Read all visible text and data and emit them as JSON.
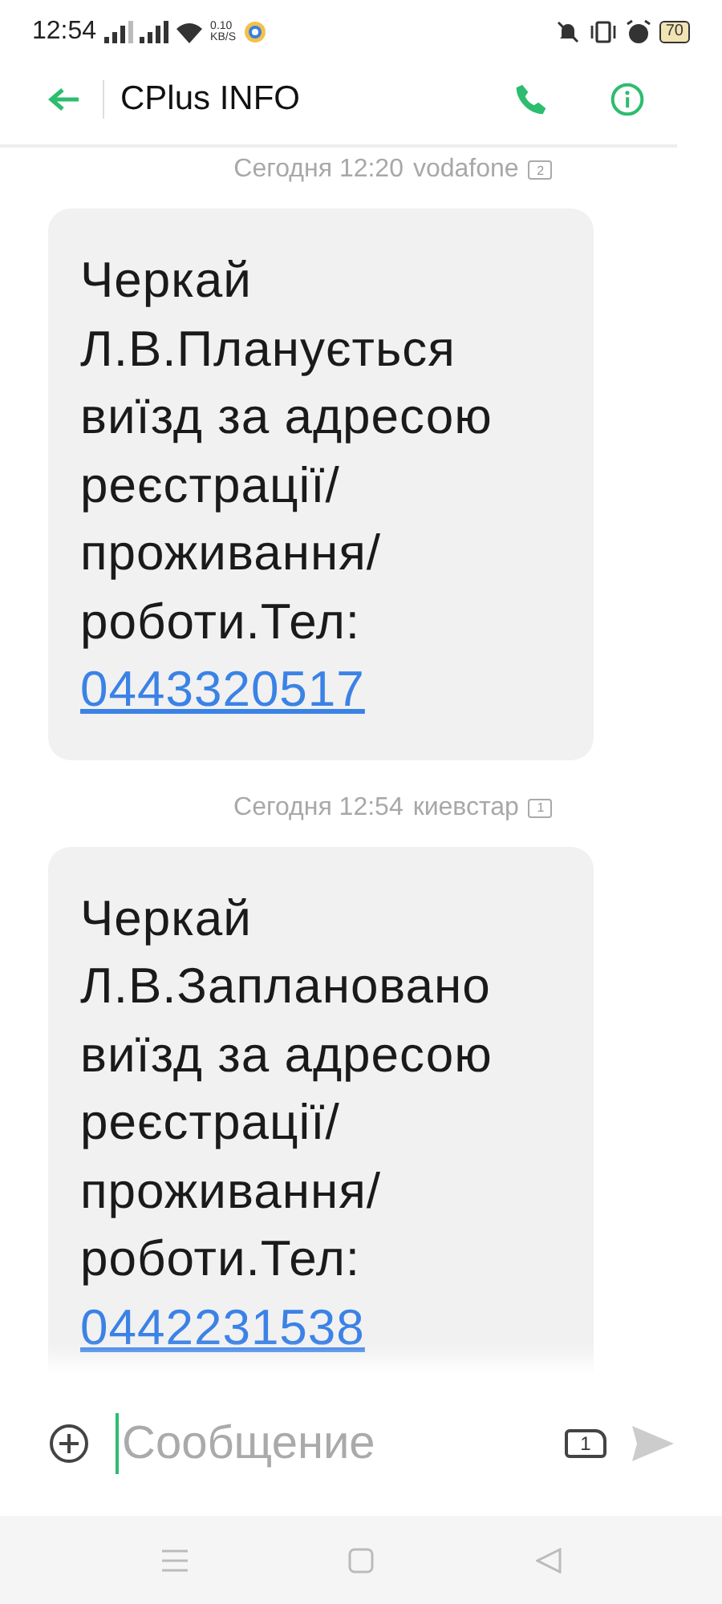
{
  "status_bar": {
    "time": "12:54",
    "speed_value": "0.10",
    "speed_unit": "KB/S",
    "battery": "70"
  },
  "header": {
    "title": "CPlus INFO"
  },
  "messages": [
    {
      "timestamp": "Сегодня 12:20",
      "carrier": "vodafone",
      "sim": "2",
      "text": "Черкай Л.В.Планується виїзд за адресою реєстрації/ проживання/ роботи.Тел:",
      "phone": "0443320517"
    },
    {
      "timestamp": "Сегодня 12:54",
      "carrier": "киевстар",
      "sim": "1",
      "text": "Черкай Л.В.Заплановано виїзд за адресою реєстрації/ проживання/ роботи.Тел:",
      "phone": "0442231538"
    }
  ],
  "composer": {
    "placeholder": "Сообщение",
    "sim": "1"
  }
}
